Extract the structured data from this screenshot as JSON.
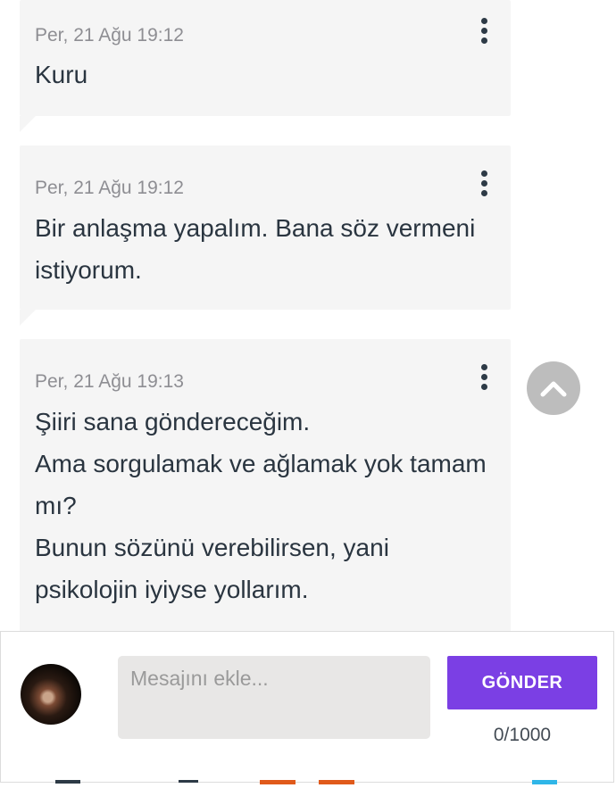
{
  "messages": [
    {
      "timestamp": "Per, 21 Ağu 19:12",
      "lines": [
        "Kuru"
      ]
    },
    {
      "timestamp": "Per, 21 Ağu 19:12",
      "lines": [
        "Bir anlaşma yapalım. Bana söz vermeni",
        "istiyorum."
      ]
    },
    {
      "timestamp": "Per, 21 Ağu 19:13",
      "lines": [
        "Şiiri sana göndereceğim.",
        "Ama sorgulamak ve ağlamak yok tamam",
        "mı?",
        "Bunun sözünü verebilirsen, yani",
        "psikolojin iyiyse yollarım."
      ]
    }
  ],
  "composer": {
    "placeholder": "Mesajını ekle...",
    "send_label": "GÖNDER",
    "counter": "0/1000"
  },
  "icons": {
    "more": "more-vertical-icon",
    "scroll_top": "chevron-up-icon"
  },
  "colors": {
    "bubble_bg": "#f5f5f5",
    "send_button": "#7b3fe4",
    "text": "#2a3540",
    "timestamp": "#8e8e93",
    "scroll_button": "#bdbdbd"
  }
}
